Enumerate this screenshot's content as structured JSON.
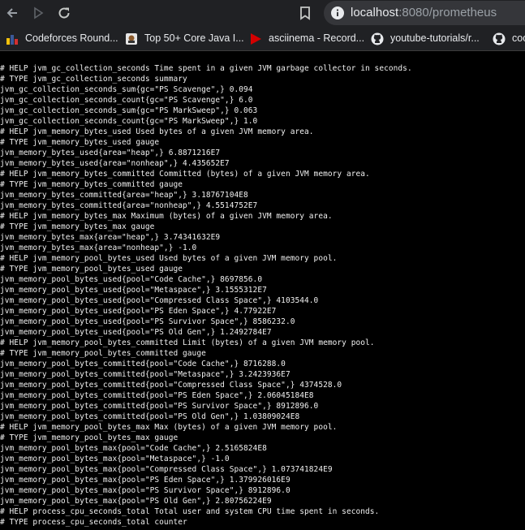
{
  "browser": {
    "url_host": "localhost",
    "url_rest": ":8080/prometheus",
    "bookmarks": [
      {
        "label": "Codeforces Round...",
        "icon": "codeforces-icon"
      },
      {
        "label": "Top 50+ Core Java I...",
        "icon": "java-icon"
      },
      {
        "label": "asciinema - Record...",
        "icon": "asciinema-icon"
      },
      {
        "label": "youtube-tutorials/r...",
        "icon": "github-icon"
      },
      {
        "label": "coc",
        "icon": "github-icon"
      }
    ]
  },
  "colors": {
    "page_bg": "#000000",
    "text": "#f0f0f0",
    "toolbar_bg": "#202124"
  },
  "lines": [
    "# HELP jvm_gc_collection_seconds Time spent in a given JVM garbage collector in seconds.",
    "# TYPE jvm_gc_collection_seconds summary",
    "jvm_gc_collection_seconds_sum{gc=\"PS Scavenge\",} 0.094",
    "jvm_gc_collection_seconds_count{gc=\"PS Scavenge\",} 6.0",
    "jvm_gc_collection_seconds_sum{gc=\"PS MarkSweep\",} 0.063",
    "jvm_gc_collection_seconds_count{gc=\"PS MarkSweep\",} 1.0",
    "# HELP jvm_memory_bytes_used Used bytes of a given JVM memory area.",
    "# TYPE jvm_memory_bytes_used gauge",
    "jvm_memory_bytes_used{area=\"heap\",} 6.8871216E7",
    "jvm_memory_bytes_used{area=\"nonheap\",} 4.435652E7",
    "# HELP jvm_memory_bytes_committed Committed (bytes) of a given JVM memory area.",
    "# TYPE jvm_memory_bytes_committed gauge",
    "jvm_memory_bytes_committed{area=\"heap\",} 3.18767104E8",
    "jvm_memory_bytes_committed{area=\"nonheap\",} 4.5514752E7",
    "# HELP jvm_memory_bytes_max Maximum (bytes) of a given JVM memory area.",
    "# TYPE jvm_memory_bytes_max gauge",
    "jvm_memory_bytes_max{area=\"heap\",} 3.74341632E9",
    "jvm_memory_bytes_max{area=\"nonheap\",} -1.0",
    "# HELP jvm_memory_pool_bytes_used Used bytes of a given JVM memory pool.",
    "# TYPE jvm_memory_pool_bytes_used gauge",
    "jvm_memory_pool_bytes_used{pool=\"Code Cache\",} 8697856.0",
    "jvm_memory_pool_bytes_used{pool=\"Metaspace\",} 3.1555312E7",
    "jvm_memory_pool_bytes_used{pool=\"Compressed Class Space\",} 4103544.0",
    "jvm_memory_pool_bytes_used{pool=\"PS Eden Space\",} 4.77922E7",
    "jvm_memory_pool_bytes_used{pool=\"PS Survivor Space\",} 8586232.0",
    "jvm_memory_pool_bytes_used{pool=\"PS Old Gen\",} 1.2492784E7",
    "# HELP jvm_memory_pool_bytes_committed Limit (bytes) of a given JVM memory pool.",
    "# TYPE jvm_memory_pool_bytes_committed gauge",
    "jvm_memory_pool_bytes_committed{pool=\"Code Cache\",} 8716288.0",
    "jvm_memory_pool_bytes_committed{pool=\"Metaspace\",} 3.2423936E7",
    "jvm_memory_pool_bytes_committed{pool=\"Compressed Class Space\",} 4374528.0",
    "jvm_memory_pool_bytes_committed{pool=\"PS Eden Space\",} 2.06045184E8",
    "jvm_memory_pool_bytes_committed{pool=\"PS Survivor Space\",} 8912896.0",
    "jvm_memory_pool_bytes_committed{pool=\"PS Old Gen\",} 1.03809024E8",
    "# HELP jvm_memory_pool_bytes_max Max (bytes) of a given JVM memory pool.",
    "# TYPE jvm_memory_pool_bytes_max gauge",
    "jvm_memory_pool_bytes_max{pool=\"Code Cache\",} 2.5165824E8",
    "jvm_memory_pool_bytes_max{pool=\"Metaspace\",} -1.0",
    "jvm_memory_pool_bytes_max{pool=\"Compressed Class Space\",} 1.073741824E9",
    "jvm_memory_pool_bytes_max{pool=\"PS Eden Space\",} 1.379926016E9",
    "jvm_memory_pool_bytes_max{pool=\"PS Survivor Space\",} 8912896.0",
    "jvm_memory_pool_bytes_max{pool=\"PS Old Gen\",} 2.80756224E9",
    "# HELP process_cpu_seconds_total Total user and system CPU time spent in seconds.",
    "# TYPE process_cpu_seconds_total counter"
  ]
}
